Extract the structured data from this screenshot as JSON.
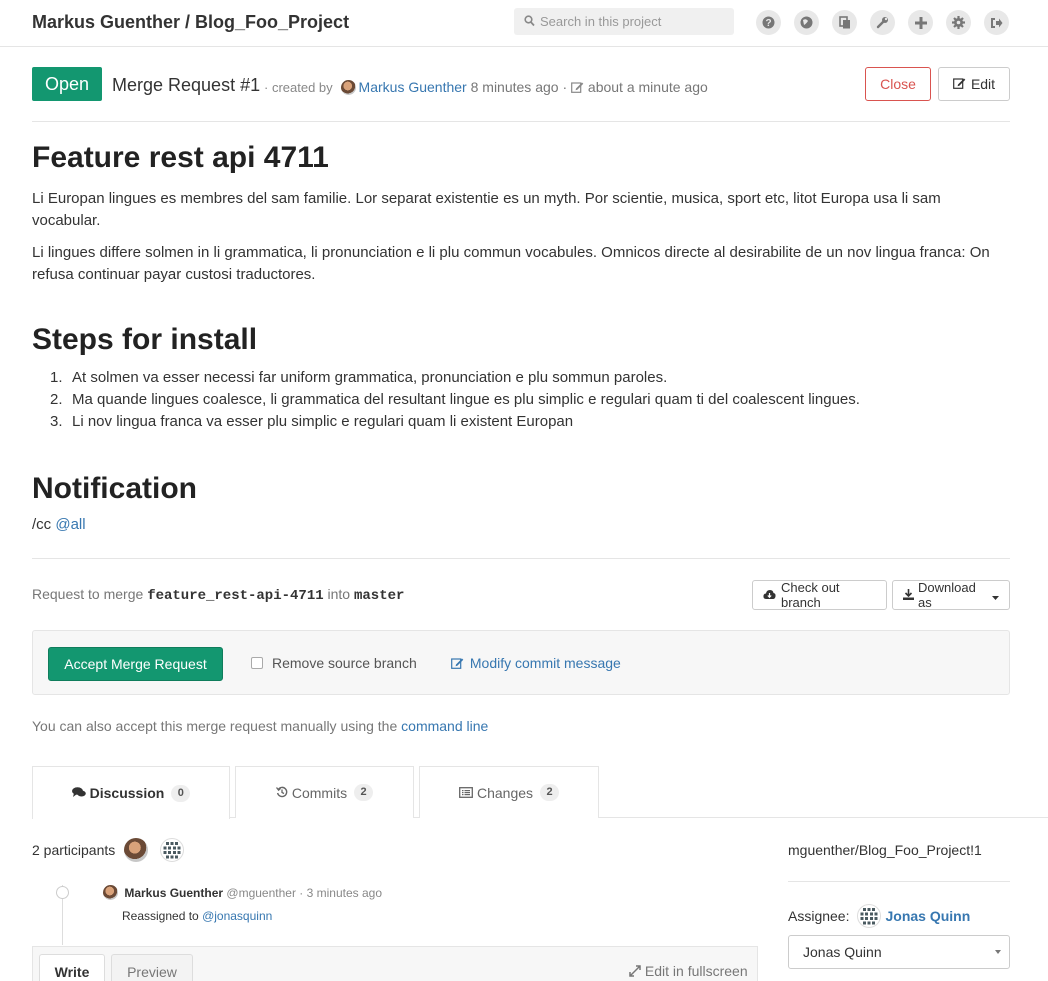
{
  "header": {
    "title": "Markus Guenther / Blog_Foo_Project",
    "search_placeholder": "Search in this project",
    "icons": [
      "help-icon",
      "globe-icon",
      "copy-icon",
      "wrench-icon",
      "plus-icon",
      "gear-icon",
      "sign-out-icon"
    ]
  },
  "mr": {
    "status": "Open",
    "number": "Merge Request #1",
    "created_by_prefix": "· created by",
    "author": "Markus Guenther",
    "created_ago": "8 minutes ago",
    "separator": "·",
    "edited_ago": "about a minute ago",
    "close_label": "Close",
    "edit_label": "Edit"
  },
  "description": {
    "title": "Feature rest api 4711",
    "paragraph1": "Li Europan lingues es membres del sam familie. Lor separat existentie es un myth. Por scientie, musica, sport etc, litot Europa usa li sam vocabular.",
    "paragraph2": "Li lingues differe solmen in li grammatica, li pronunciation e li plu commun vocabules. Omnicos directe al desirabilite de un nov lingua franca: On refusa continuar payar custosi traductores.",
    "steps_heading": "Steps for install",
    "steps": [
      {
        "num": "1.",
        "text": "At solmen va esser necessi far uniform grammatica, pronunciation e plu sommun paroles."
      },
      {
        "num": "2.",
        "text": "Ma quande lingues coalesce, li grammatica del resultant lingue es plu simplic e regulari quam ti del coalescent lingues."
      },
      {
        "num": "3.",
        "text": "Li nov lingua franca va esser plu simplic e regulari quam li existent Europan"
      }
    ],
    "notification_heading": "Notification",
    "cc_prefix": "/cc",
    "cc_mention": "@all"
  },
  "merge": {
    "request_to_merge": "Request to merge",
    "source_branch": "feature_rest-api-4711",
    "into": "into",
    "target_branch": "master",
    "checkout_label": "Check out branch",
    "download_label": "Download as",
    "accept_label": "Accept Merge Request",
    "remove_source_label": "Remove source branch",
    "modify_commit_label": "Modify commit message",
    "manual_text": "You can also accept this merge request manually using the",
    "command_line_link": "command line"
  },
  "tabs": [
    {
      "label": "Discussion",
      "count": "0"
    },
    {
      "label": "Commits",
      "count": "2"
    },
    {
      "label": "Changes",
      "count": "2"
    }
  ],
  "discussion": {
    "participants_label": "2 participants",
    "note_author": "Markus Guenther",
    "note_handle": "@mguenther",
    "note_time": "· 3 minutes ago",
    "note_body_prefix": "Reassigned to",
    "note_body_mention": "@jonasquinn",
    "write_tab": "Write",
    "preview_tab": "Preview",
    "fullscreen_label": "Edit in fullscreen"
  },
  "sidebar": {
    "reference": "mguenther/Blog_Foo_Project!1",
    "assignee_label": "Assignee:",
    "assignee_name": "Jonas Quinn",
    "assignee_select_value": "Jonas Quinn"
  },
  "colors": {
    "accent_green": "#139770",
    "link_blue": "#3777b0",
    "danger_red": "#d9534f"
  }
}
